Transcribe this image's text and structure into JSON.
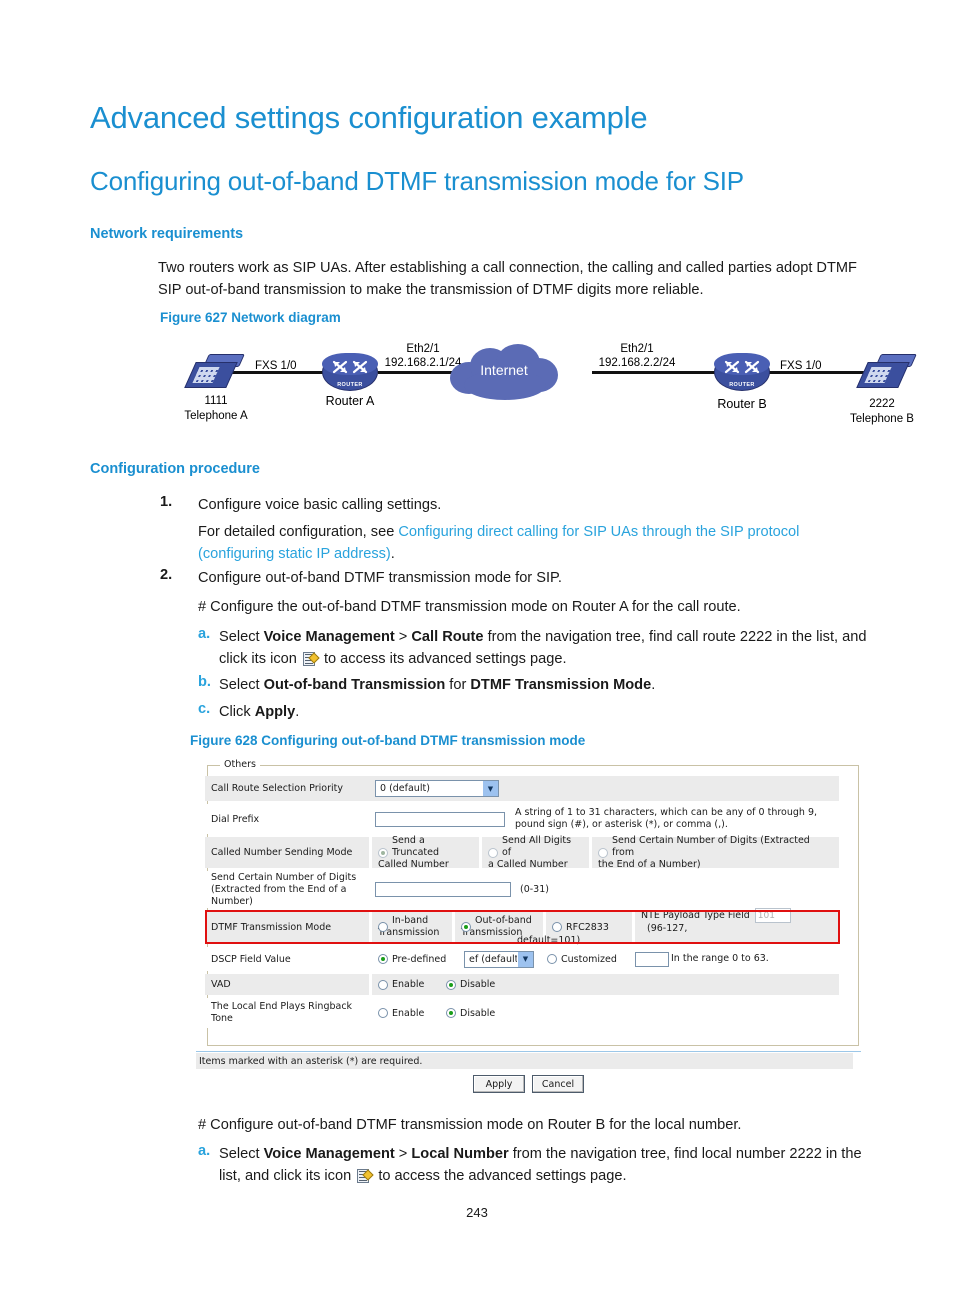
{
  "headings": {
    "h1": "Advanced settings configuration example",
    "h2": "Configuring out-of-band DTMF transmission mode for SIP",
    "network_requirements": "Network requirements",
    "configuration_procedure": "Configuration procedure"
  },
  "intro": {
    "text": "Two routers work as SIP UAs. After establishing a call connection, the calling and called parties adopt DTMF SIP out-of-band transmission to make the transmission of DTMF digits more reliable."
  },
  "figures": {
    "fig627_caption": "Figure 627 Network diagram",
    "fig628_caption": "Figure 628 Configuring out-of-band DTMF transmission mode"
  },
  "diagram": {
    "phone_a_number": "1111",
    "phone_a_label": "Telephone A",
    "phone_b_number": "2222",
    "phone_b_label": "Telephone B",
    "router_a_label": "Router A",
    "router_b_label": "Router B",
    "router_badge": "ROUTER",
    "fxs_left": "FXS 1/0",
    "fxs_right": "FXS 1/0",
    "eth_left_line1": "Eth2/1",
    "eth_left_line2": "192.168.2.1/24",
    "eth_right_line1": "Eth2/1",
    "eth_right_line2": "192.168.2.2/24",
    "cloud_label": "Internet"
  },
  "steps": {
    "n1": "1.",
    "n2": "2.",
    "a": "a.",
    "b": "b.",
    "c": "c.",
    "step1": "Configure voice basic calling settings.",
    "step1_detail_prefix": "For detailed configuration, see ",
    "step1_detail_link": "Configuring direct calling for SIP UAs through the SIP protocol (configuring static IP address)",
    "step1_detail_suffix": ".",
    "step2": "Configure out-of-band DTMF transmission mode for SIP.",
    "step2_detail": "# Configure the out-of-band DTMF transmission mode on Router A for the call route.",
    "a_pre": "Select ",
    "a_bold1": "Voice Management",
    "a_mid1": " > ",
    "a_bold2": "Call Route",
    "a_mid2": " from the navigation tree, find call route 2222 in the list, and click its icon ",
    "a_post": " to access its advanced settings page.",
    "b_pre": "Select ",
    "b_bold1": "Out-of-band Transmission",
    "b_mid": " for ",
    "b_bold2": "DTMF Transmission Mode",
    "b_post": ".",
    "c_pre": "Click ",
    "c_bold": "Apply",
    "c_post": ".",
    "tail_hash": "# Configure out-of-band DTMF transmission mode on Router B for the local number.",
    "a2_pre": "Select ",
    "a2_bold1": "Voice Management",
    "a2_mid1": " > ",
    "a2_bold2": "Local Number",
    "a2_mid2": " from the navigation tree, find local number 2222 in the list, and click its icon ",
    "a2_post": " to access the advanced settings page."
  },
  "form": {
    "legend": "Others",
    "rows": {
      "call_route_priority": {
        "label": "Call Route Selection Priority",
        "value": "0 (default)"
      },
      "dial_prefix": {
        "label": "Dial Prefix",
        "value": "",
        "hint_line1": "A string of 1 to 31 characters, which can be any of 0 through 9,",
        "hint_line2": "pound sign (#), or asterisk (*), or comma (,)."
      },
      "called_number_sending_mode": {
        "label": "Called Number Sending Mode",
        "options": [
          {
            "label_line1": "Send a Truncated",
            "label_line2": "Called Number",
            "selected": true
          },
          {
            "label_line1": "Send All Digits of",
            "label_line2": "a Called Number",
            "selected": false
          },
          {
            "label_line1": "Send Certain Number of Digits (Extracted from",
            "label_line2": "the End of a Number)",
            "selected": false
          }
        ]
      },
      "send_certain_digits": {
        "label_line1": "Send Certain Number of Digits",
        "label_line2": "(Extracted from the End of a",
        "label_line3": "Number)",
        "value": "",
        "hint": "(0-31)"
      },
      "dtmf_transmission_mode": {
        "label": "DTMF Transmission Mode",
        "options": [
          {
            "label_line1": "In-band",
            "label_line2": "Transmission",
            "selected": false
          },
          {
            "label_line1": "Out-of-band",
            "label_line2": "Transmission",
            "selected": true
          },
          {
            "label_line1": "RFC2833",
            "label_line2": "",
            "selected": false
          }
        ],
        "nte_label": "NTE Payload Type Field",
        "nte_value": "101",
        "nte_hint_line1": "(96-127,",
        "nte_hint_line2": "default=101)",
        "highlighted": true,
        "highlight_color": "#e01010"
      },
      "dscp_field_value": {
        "label": "DSCP Field Value",
        "predefined_label": "Pre-defined",
        "predefined_selected": true,
        "predefined_value": "ef (default)",
        "customized_label": "Customized",
        "customized_selected": false,
        "customized_value": "",
        "hint": "In the range 0 to 63."
      },
      "vad": {
        "label": "VAD",
        "enable_label": "Enable",
        "disable_label": "Disable",
        "selected": "Disable"
      },
      "ringback_tone": {
        "label_line1": "The Local End Plays Ringback",
        "label_line2": "Tone",
        "enable_label": "Enable",
        "disable_label": "Disable",
        "selected": "Disable"
      }
    },
    "status_note": "Items marked with an asterisk (*) are required.",
    "apply_button": "Apply",
    "cancel_button": "Cancel"
  },
  "footer": {
    "page_number": "243"
  },
  "colors": {
    "heading_blue": "#1a8fd0",
    "link_blue": "#29a3dd",
    "diagram_blue": "#3b4f9e",
    "cloud_blue": "#5b6bb5",
    "highlight_red": "#e01010"
  }
}
